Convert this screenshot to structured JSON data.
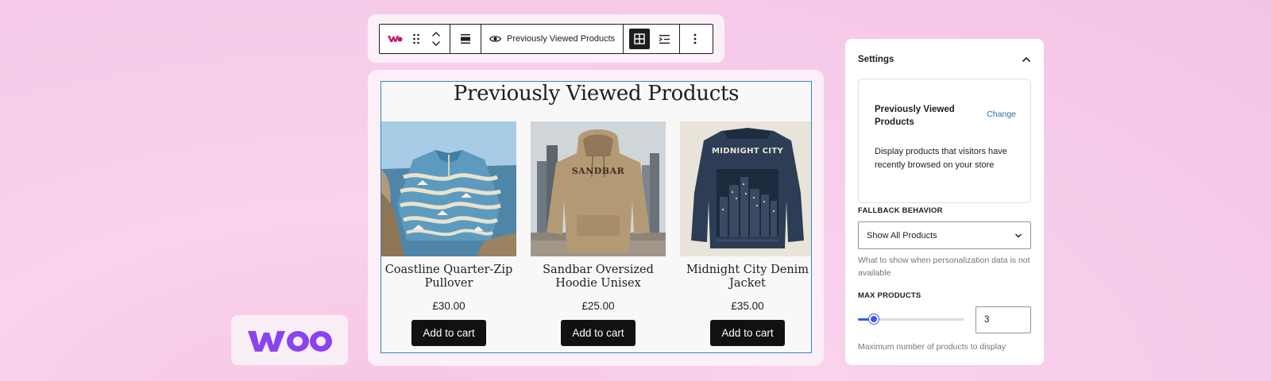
{
  "toolbar": {
    "block_name": "Previously Viewed Products",
    "icons": [
      "woo-block-icon",
      "drag-handle-icon",
      "move-up-icon",
      "move-down-icon",
      "align-icon",
      "eye-icon",
      "grid-view-icon",
      "list-view-icon",
      "more-options-icon"
    ]
  },
  "block": {
    "title": "Previously Viewed Products",
    "products": [
      {
        "name": "Coastline Quarter-Zip Pullover",
        "price": "£30.00",
        "button": "Add to cart"
      },
      {
        "name": "Sandbar Oversized Hoodie Unisex",
        "price": "£25.00",
        "button": "Add to cart",
        "print": "SANDBAR"
      },
      {
        "name": "Midnight City Denim Jacket",
        "price": "£35.00",
        "button": "Add to cart",
        "print": "MIDNIGHT CITY"
      }
    ]
  },
  "settings": {
    "title": "Settings",
    "pattern_name": "Previously Viewed Products",
    "change_label": "Change",
    "pattern_description": "Display products that visitors have recently browsed on your store",
    "fallback_label": "FALLBACK BEHAVIOR",
    "fallback_value": "Show All Products",
    "fallback_help": "What to show when personalization data is not available",
    "max_label": "MAX PRODUCTS",
    "max_value": "3",
    "max_slider_fraction": 0.15,
    "max_help": "Maximum number of products to display"
  },
  "brand": {
    "logo": "woo",
    "accent": "#7f54b3",
    "block_outline": "#3883c4",
    "slider_color": "#3858e9"
  }
}
